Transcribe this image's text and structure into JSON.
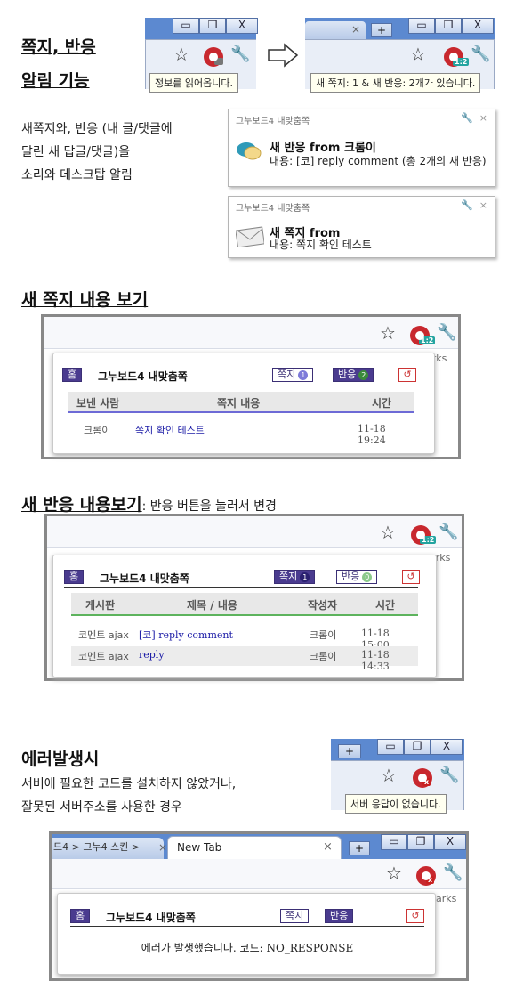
{
  "section1": {
    "title_line1": "쪽지, 반응",
    "title_line2": "알림 기능",
    "tooltip_before": "정보를 읽어옵니다.",
    "tooltip_after": "새 쪽지: 1 & 새 반응: 2개가 있습니다.",
    "badge_after": "1:2",
    "desc_line1": "새쪽지와, 반응 (내 글/댓글에",
    "desc_line2": "달린 새 답글/댓글)을",
    "desc_line3": "소리와 데스크탑 알림",
    "notif1": {
      "header": "그누보드4 내맞춤쪽",
      "title": "새 반응 from 크롬이",
      "body": "내용: [코] reply comment (총 2개의 새 반응)"
    },
    "notif2": {
      "header": "그누보드4 내맞춤쪽",
      "title": "새 쪽지 from",
      "body": "내용: 쪽지 확인 테스트"
    }
  },
  "section2": {
    "title": "새 쪽지 내용 보기",
    "badge": "1:2",
    "bookmarks_text": "arks",
    "popup": {
      "home": "홈",
      "name": "그누보드4 내맞춤쪽",
      "memo_btn": "쪽지",
      "memo_count": "1",
      "react_btn": "반응",
      "react_count": "2",
      "refresh": "↺",
      "headers": [
        "보낸 사람",
        "쪽지 내용",
        "시간"
      ],
      "rows": [
        {
          "sender": "크롬이",
          "content": "쪽지 확인 테스트",
          "time": "11-18 19:24"
        }
      ]
    }
  },
  "section3": {
    "title": "새 반응 내용보기",
    "subtitle": ":  반응 버튼을 눌러서 변경",
    "badge": "1:2",
    "bookmarks_text": "arks",
    "popup": {
      "home": "홈",
      "name": "그누보드4 내맞춤쪽",
      "memo_btn": "쪽지",
      "memo_count": "1",
      "react_btn": "반응",
      "react_count": "0",
      "refresh": "↺",
      "headers": [
        "게시판",
        "제목 / 내용",
        "작성자",
        "시간"
      ],
      "rows": [
        {
          "board": "코멘트 ajax",
          "subject": "[코] reply comment",
          "author": "크롬이",
          "time": "11-18 15:00"
        },
        {
          "board": "코멘트 ajax",
          "subject": "reply",
          "author": "크롬이",
          "time": "11-18 14:33"
        }
      ]
    }
  },
  "section4": {
    "title": "에러발생시",
    "desc_line1": "서버에 필요한 코드를 설치하지 않았거나,",
    "desc_line2": "잘못된 서버주소를 사용한 경우",
    "tooltip": "서버 응답이 없습니다.",
    "tab_left": "드4 > 그누4 스킨 > ",
    "tab_active": "New Tab",
    "bookmarks_text": "arks",
    "popup": {
      "home": "홈",
      "name": "그누보드4 내맞춤쪽",
      "memo_btn": "쪽지",
      "react_btn": "반응",
      "refresh": "↺",
      "error": "에러가 발생했습니다. 코드: NO_RESPONSE"
    }
  },
  "colors": {
    "accent": "#4a3b8f",
    "react_line": "#5db35d",
    "memo_line": "#6d6ad6",
    "icon_red": "#c8282e",
    "badge": "#24a4a0"
  }
}
